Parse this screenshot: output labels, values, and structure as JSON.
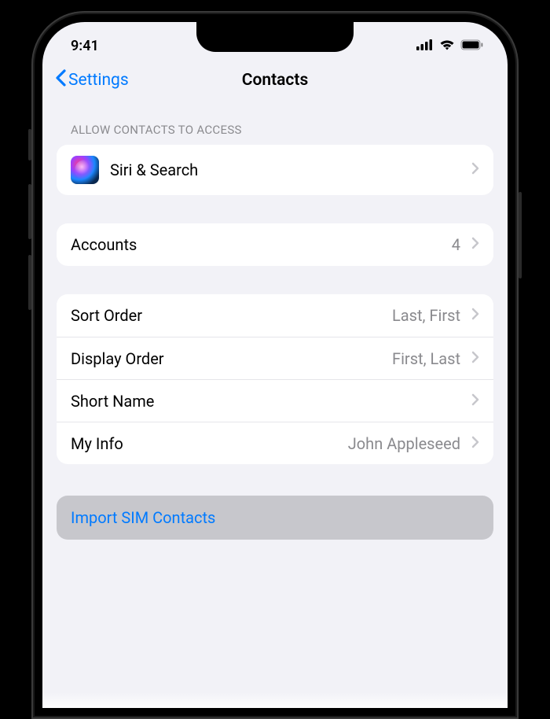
{
  "status": {
    "time": "9:41"
  },
  "nav": {
    "back_label": "Settings",
    "title": "Contacts"
  },
  "section_headers": {
    "allow_access": "ALLOW CONTACTS TO ACCESS"
  },
  "rows": {
    "siri": {
      "label": "Siri & Search"
    },
    "accounts": {
      "label": "Accounts",
      "value": "4"
    },
    "sort_order": {
      "label": "Sort Order",
      "value": "Last, First"
    },
    "display_order": {
      "label": "Display Order",
      "value": "First, Last"
    },
    "short_name": {
      "label": "Short Name"
    },
    "my_info": {
      "label": "My Info",
      "value": "John Appleseed"
    }
  },
  "import_button": {
    "label": "Import SIM Contacts"
  }
}
